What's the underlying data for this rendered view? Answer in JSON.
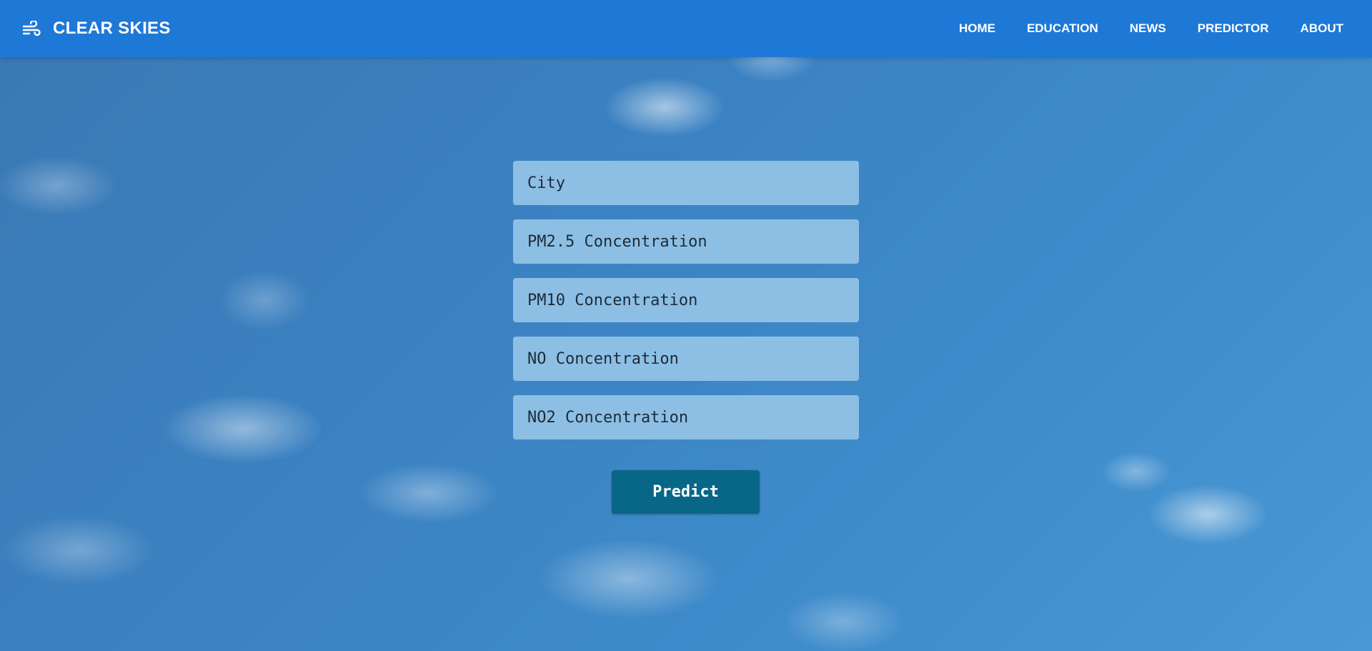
{
  "navbar": {
    "brand_icon": "wind-icon",
    "brand_name": "CLEAR SKIES",
    "links": [
      {
        "label": "HOME"
      },
      {
        "label": "EDUCATION"
      },
      {
        "label": "NEWS"
      },
      {
        "label": "PREDICTOR"
      },
      {
        "label": "ABOUT"
      }
    ],
    "background_color": "#1e78d6"
  },
  "form": {
    "fields": [
      {
        "placeholder": "City",
        "value": ""
      },
      {
        "placeholder": "PM2.5 Concentration",
        "value": ""
      },
      {
        "placeholder": "PM10 Concentration",
        "value": ""
      },
      {
        "placeholder": "NO Concentration",
        "value": ""
      },
      {
        "placeholder": "NO2 Concentration",
        "value": ""
      }
    ],
    "submit_label": "Predict",
    "field_color": "#8dbfe4",
    "button_color": "#086687"
  }
}
